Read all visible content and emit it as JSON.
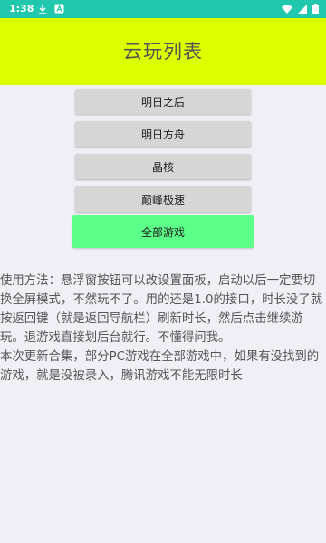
{
  "status_bar": {
    "time": "1:38",
    "left_icons": [
      "download-icon",
      "notification-a-icon"
    ],
    "right_icons": [
      "wifi-icon",
      "signal-icon",
      "battery-icon"
    ],
    "background": "#21c8ad"
  },
  "header": {
    "title": "云玩列表",
    "background": "#dcff00"
  },
  "buttons": [
    {
      "label": "明日之后"
    },
    {
      "label": "明日方舟"
    },
    {
      "label": "晶核"
    },
    {
      "label": "巅峰极速"
    }
  ],
  "all_games_button": {
    "label": "全部游戏",
    "background": "#5cff88"
  },
  "description": {
    "usage": "使用方法：悬浮窗按钮可以改设置面板，启动以后一定要切换全屏模式，不然玩不了。用的还是1.0的接口，时长没了就按返回键（就是返回导航栏）刷新时长，然后点击继续游玩。退游戏直接划后台就行。不懂得问我。",
    "update": "本次更新合集，部分PC游戏在全部游戏中，如果有没找到的游戏，就是没被录入，腾讯游戏不能无限时长"
  }
}
